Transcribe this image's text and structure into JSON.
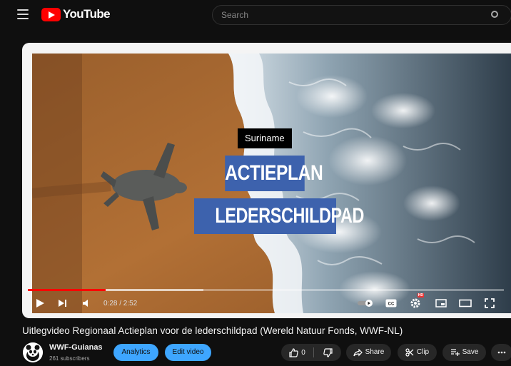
{
  "header": {
    "logo_text": "YouTube",
    "search_placeholder": "Search"
  },
  "video": {
    "overlay_tag": "Suriname",
    "overlay_title_1": "ACTIEPLAN",
    "overlay_title_2": "LEDERSCHILDPAD",
    "time": "0:28 / 2:52",
    "progress": 0.163
  },
  "details": {
    "title": "Uitlegvideo Regionaal Actieplan voor de lederschildpad (Wereld Natuur Fonds, WWF-NL)",
    "channel_name": "WWF-Guianas",
    "subscribers": "261 subscribers",
    "analytics_label": "Analytics",
    "edit_label": "Edit video",
    "like_count": "0",
    "share_label": "Share",
    "clip_label": "Clip",
    "save_label": "Save"
  },
  "colors": {
    "accent_blue": "#3ea6ff",
    "brand_red": "#ff0000",
    "title_box": "#3d62ad"
  }
}
